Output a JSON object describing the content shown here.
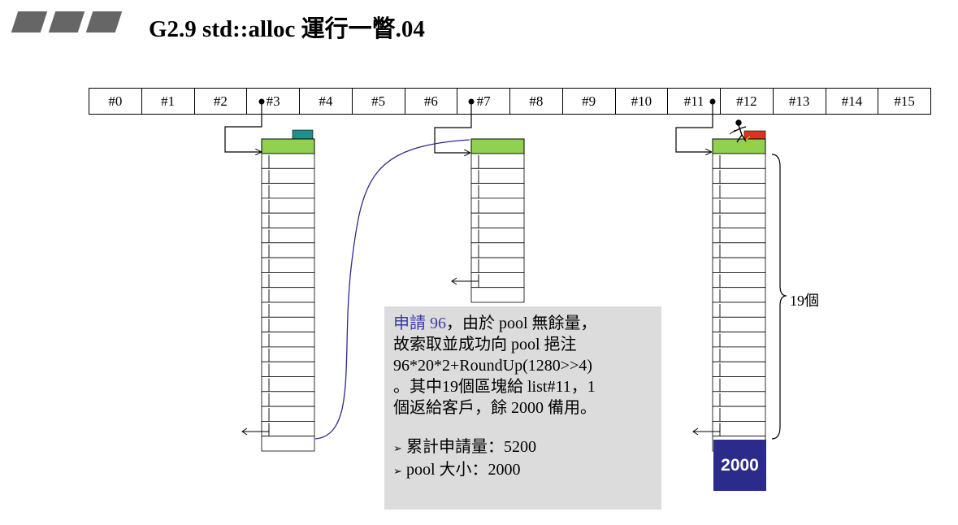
{
  "header": {
    "title": "G2.9 std::alloc 運行一瞥.04"
  },
  "free_list": {
    "slots": [
      "#0",
      "#1",
      "#2",
      "#3",
      "#4",
      "#5",
      "#6",
      "#7",
      "#8",
      "#9",
      "#10",
      "#11",
      "#12",
      "#13",
      "#14",
      "#15"
    ]
  },
  "pool": {
    "remaining_label": "2000"
  },
  "brace": {
    "label": "19個"
  },
  "info": {
    "highlight": "申請 96",
    "line1_rest": "，由於 pool 無餘量，",
    "line2": "故索取並成功向 pool 挹注",
    "line3": "96*20*2+RoundUp(1280>>4)",
    "line4": "。其中19個區塊給 list#11，1",
    "line5": "個返給客戶，餘 2000 備用。",
    "bullets": [
      "累計申請量：5200",
      "pool 大小：2000"
    ]
  },
  "colors": {
    "block_header": "#92d050",
    "teal_tab": "#1f8f8f",
    "red_tab": "#e03020",
    "pool_block": "#2b2b8c",
    "info_bg": "#dcdcdc"
  }
}
